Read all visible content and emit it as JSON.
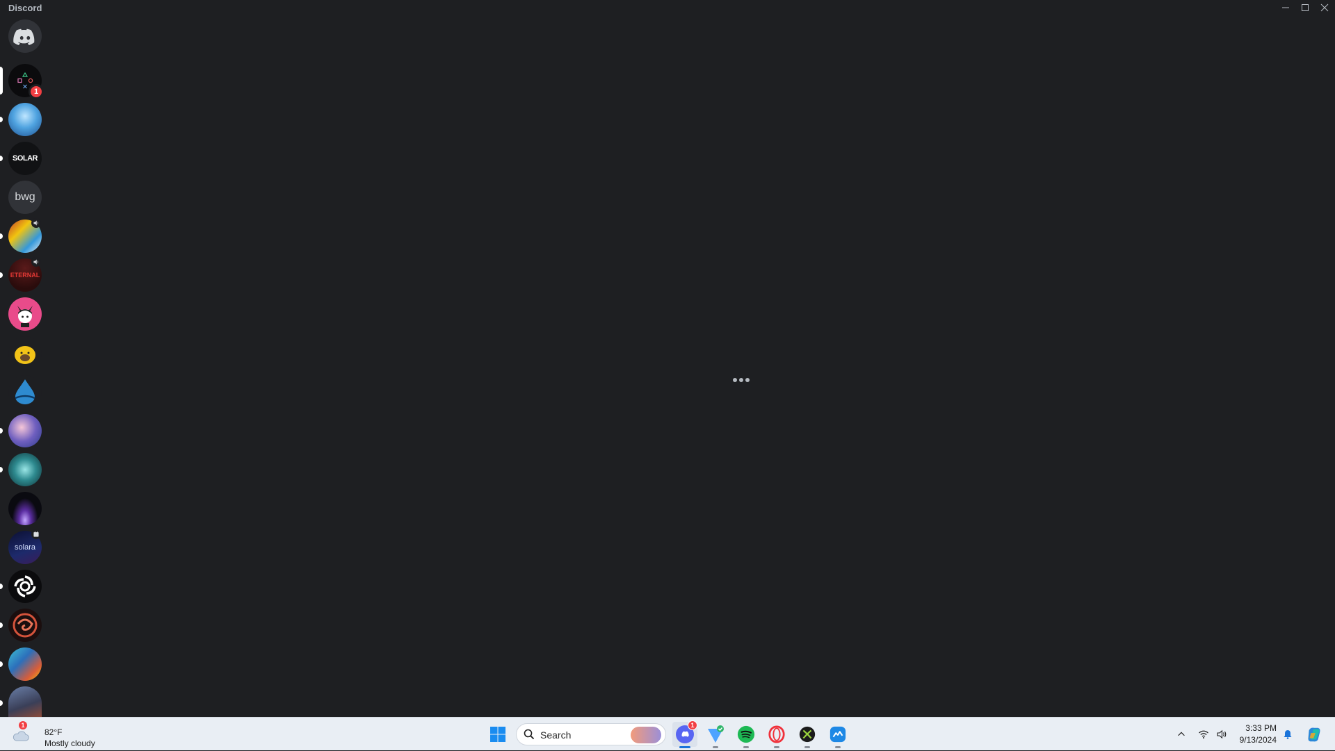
{
  "window": {
    "title": "Discord",
    "controls": [
      "minimize-icon",
      "maximize-icon",
      "close-icon"
    ]
  },
  "servers": [
    {
      "name": "discord-home",
      "label": "",
      "color": "#5865f2"
    },
    {
      "name": "playstation",
      "label": "",
      "badge": "1",
      "selected": true
    },
    {
      "name": "anime-blue",
      "label": ""
    },
    {
      "name": "solar",
      "label": "SOLAR",
      "unread": true
    },
    {
      "name": "bwg",
      "label": "bwg"
    },
    {
      "name": "anime-collage",
      "label": "",
      "unread": true,
      "voice": true
    },
    {
      "name": "eternal",
      "label": "ETERNAL",
      "unread": true,
      "voice": true
    },
    {
      "name": "kuromi",
      "label": ""
    },
    {
      "name": "duck",
      "label": ""
    },
    {
      "name": "water-drop",
      "label": ""
    },
    {
      "name": "anime-character",
      "label": "",
      "unread": true
    },
    {
      "name": "teal-art",
      "label": "",
      "unread": true
    },
    {
      "name": "purple-planet",
      "label": ""
    },
    {
      "name": "solara",
      "label": "solara",
      "event": true
    },
    {
      "name": "swirl",
      "label": ""
    },
    {
      "name": "red-swirl",
      "label": "",
      "unread": true
    },
    {
      "name": "fantasy-art",
      "label": "",
      "unread": true
    },
    {
      "name": "character-art",
      "label": "",
      "unread": true
    }
  ],
  "taskbar": {
    "weather": {
      "temp": "82°F",
      "desc": "Mostly cloudy",
      "badge": "1"
    },
    "search_placeholder": "Search",
    "apps": [
      {
        "name": "discord",
        "badge": "1"
      },
      {
        "name": "vpn-check"
      },
      {
        "name": "spotify"
      },
      {
        "name": "opera"
      },
      {
        "name": "xbox"
      },
      {
        "name": "messenger"
      }
    ],
    "clock": {
      "time": "3:33 PM",
      "date": "9/13/2024"
    }
  }
}
